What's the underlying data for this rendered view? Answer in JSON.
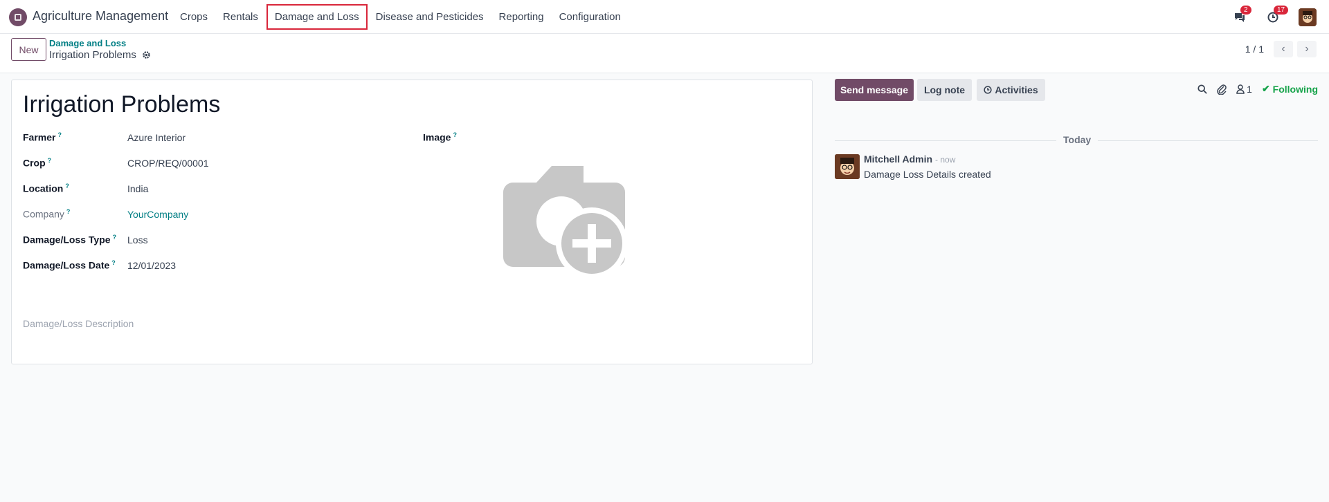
{
  "navbar": {
    "app_name": "Agriculture Management",
    "menu": [
      "Crops",
      "Rentals",
      "Damage and Loss",
      "Disease and Pesticides",
      "Reporting",
      "Configuration"
    ],
    "messages_count": "2",
    "activities_count": "17"
  },
  "control": {
    "new_label": "New",
    "breadcrumb_parent": "Damage and Loss",
    "breadcrumb_current": "Irrigation Problems",
    "pager": "1 / 1"
  },
  "form": {
    "title": "Irrigation Problems",
    "fields": {
      "farmer_label": "Farmer",
      "farmer_value": "Azure Interior",
      "crop_label": "Crop",
      "crop_value": "CROP/REQ/00001",
      "location_label": "Location",
      "location_value": "India",
      "company_label": "Company",
      "company_value": "YourCompany",
      "type_label": "Damage/Loss Type",
      "type_value": "Loss",
      "date_label": "Damage/Loss Date",
      "date_value": "12/01/2023",
      "image_label": "Image"
    },
    "description_placeholder": "Damage/Loss Description",
    "help_marker": "?"
  },
  "chatter": {
    "send_message": "Send message",
    "log_note": "Log note",
    "activities": "Activities",
    "followers_count": "1",
    "following": "Following",
    "date_separator": "Today",
    "message": {
      "author": "Mitchell Admin",
      "time": "- now",
      "body": "Damage Loss Details created"
    }
  },
  "colors": {
    "brand": "#714b67",
    "link": "#017e84",
    "badge": "#d9263a",
    "following": "#16a34a"
  }
}
